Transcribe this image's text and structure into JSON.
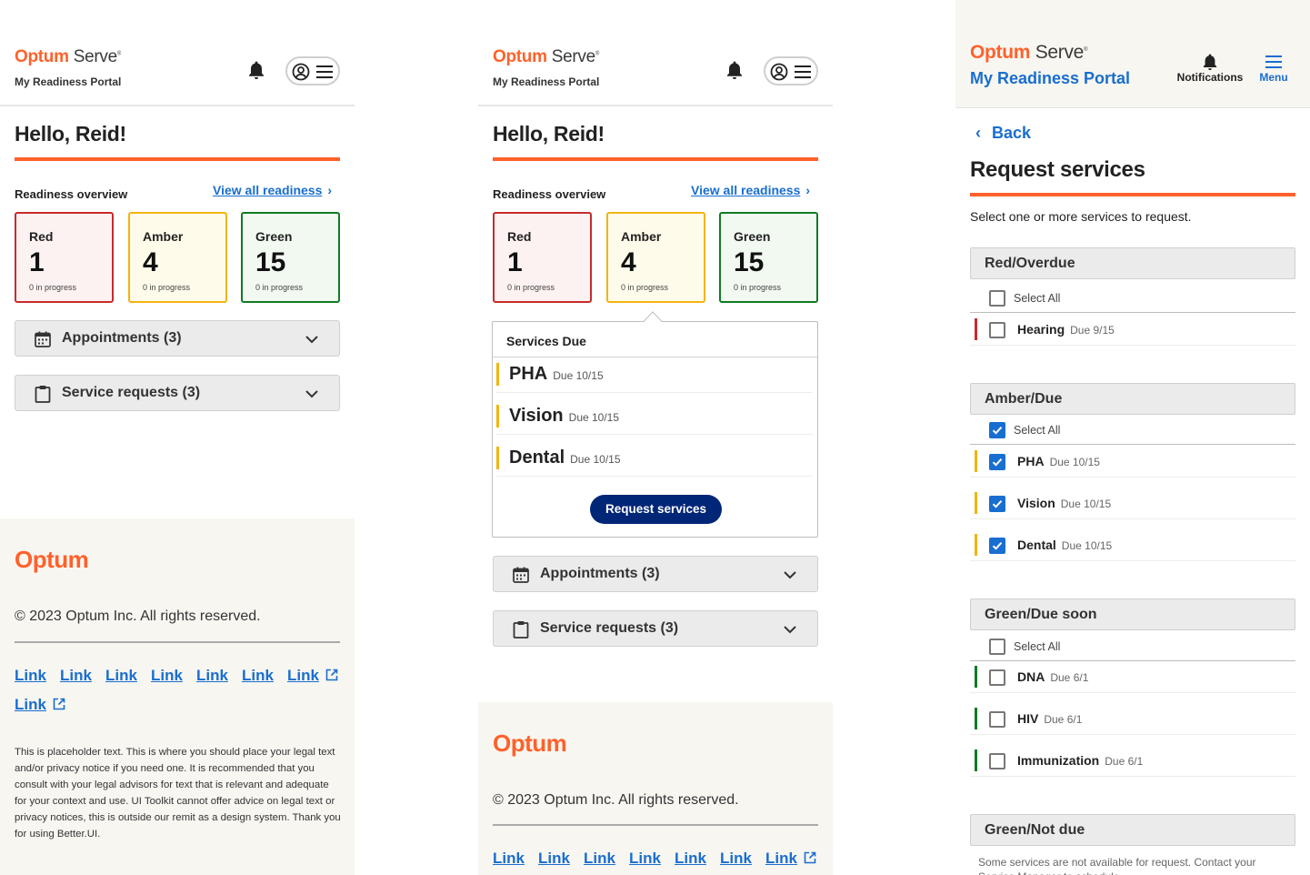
{
  "brand": {
    "logo_bold": "Optum",
    "logo_light": " Serve",
    "logo_mark": "®",
    "portal": "My Readiness Portal",
    "accent": "#ff612b",
    "link_color": "#196ecf",
    "navy": "#002677"
  },
  "home": {
    "greeting": "Hello, Reid!",
    "overview_label": "Readiness overview",
    "view_all": "View all readiness",
    "cards": [
      {
        "label": "Red",
        "count": "1",
        "progress": "0 in progress",
        "color": "#c72b2b"
      },
      {
        "label": "Amber",
        "count": "4",
        "progress": "0 in progress",
        "color": "#f2b411"
      },
      {
        "label": "Green",
        "count": "15",
        "progress": "0 in progress",
        "color": "#0f7b23"
      }
    ],
    "accordions": [
      {
        "label": "Appointments (3)",
        "icon": "calendar-icon"
      },
      {
        "label": "Service requests (3)",
        "icon": "clipboard-icon"
      }
    ]
  },
  "services_due": {
    "title": "Services Due",
    "items": [
      {
        "name": "PHA",
        "due": "Due 10/15"
      },
      {
        "name": "Vision",
        "due": "Due 10/15"
      },
      {
        "name": "Dental",
        "due": "Due 10/15"
      }
    ],
    "button": "Request services"
  },
  "footer": {
    "logo": "Optum",
    "copyright": "© 2023 Optum Inc. All rights reserved.",
    "links": [
      "Link",
      "Link",
      "Link",
      "Link",
      "Link",
      "Link",
      "Link",
      "Link"
    ],
    "legal": "This is placeholder text. This is where you should place your legal text and/or privacy notice if you need one. It is recommended that you consult with your legal advisors for text that is relevant and adequate for your context and use. UI Toolkit cannot offer advice on legal text or privacy notices, this is outside our remit as a design system. Thank you for using Better.UI."
  },
  "request": {
    "notifications": "Notifications",
    "menu": "Menu",
    "back": "Back",
    "title": "Request services",
    "subtitle": "Select one or more services to request.",
    "select_all": "Select All",
    "groups": [
      {
        "name": "Red/Overdue",
        "select_all_checked": false,
        "color": "#c72b2b",
        "items": [
          {
            "name": "Hearing",
            "due": "Due 9/15",
            "checked": false
          }
        ]
      },
      {
        "name": "Amber/Due",
        "select_all_checked": true,
        "color": "#f2b411",
        "items": [
          {
            "name": "PHA",
            "due": "Due 10/15",
            "checked": true
          },
          {
            "name": "Vision",
            "due": "Due 10/15",
            "checked": true
          },
          {
            "name": "Dental",
            "due": "Due 10/15",
            "checked": true
          }
        ]
      },
      {
        "name": "Green/Due soon",
        "select_all_checked": false,
        "color": "#0f7b23",
        "items": [
          {
            "name": "DNA",
            "due": "Due 6/1",
            "checked": false
          },
          {
            "name": "HIV",
            "due": "Due 6/1",
            "checked": false
          },
          {
            "name": "Immunization",
            "due": "Due 6/1",
            "checked": false
          }
        ]
      },
      {
        "name": "Green/Not due"
      }
    ],
    "note": "Some services are not available for request. Contact your Service Manager to schedule."
  }
}
